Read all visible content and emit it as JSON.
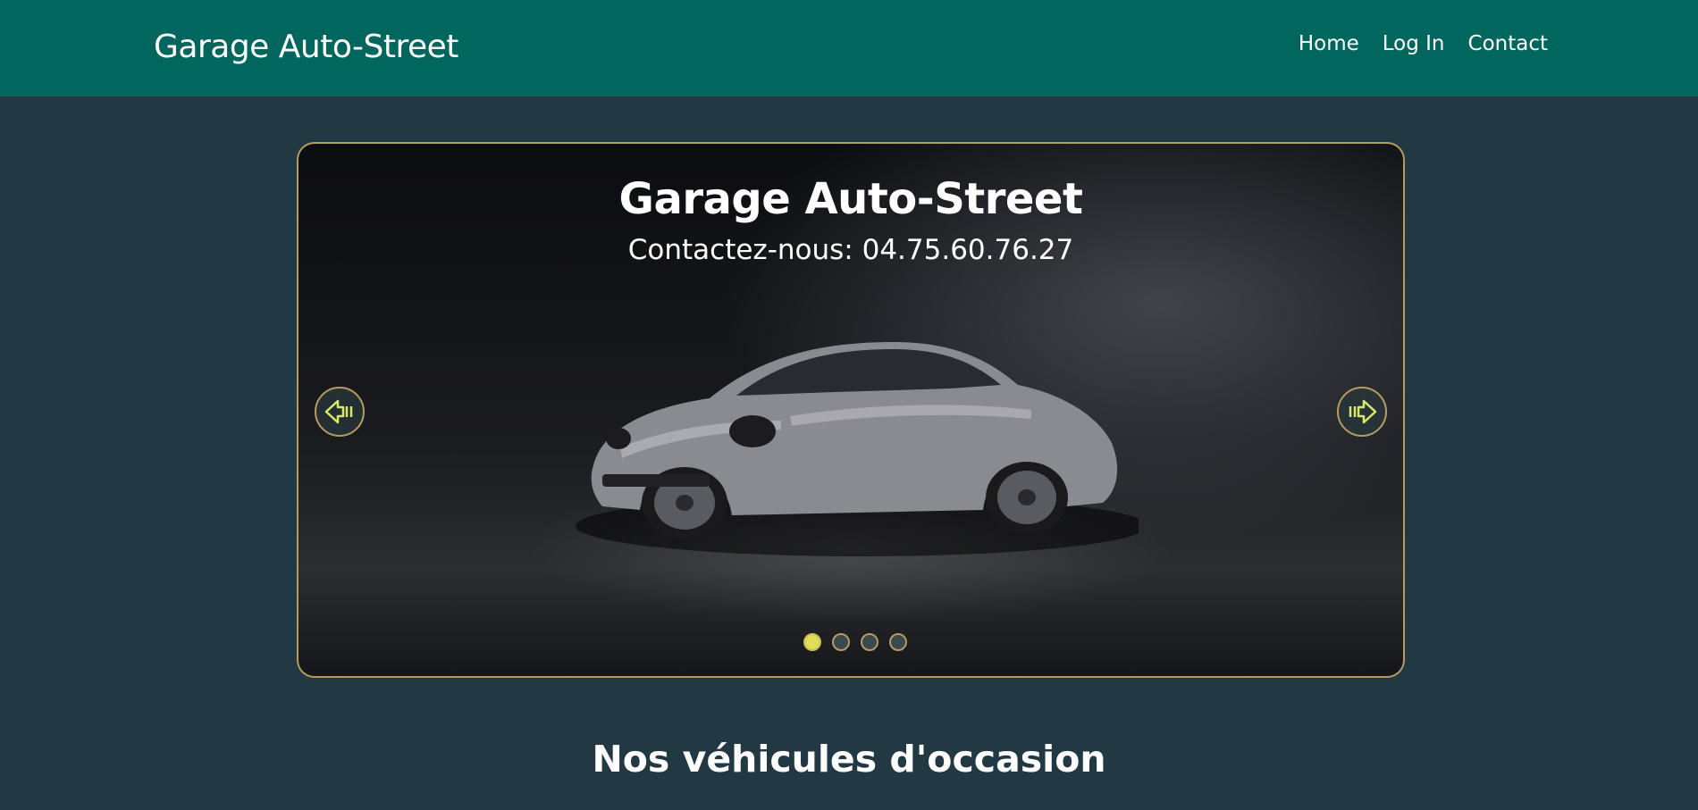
{
  "navbar": {
    "brand": "Garage Auto-Street",
    "links": [
      "Home",
      "Log In",
      "Contact"
    ]
  },
  "carousel": {
    "title": "Garage Auto-Street",
    "subtitle": "Contactez-nous: 04.75.60.76.27",
    "prev_icon": "arrow-left-icon",
    "next_icon": "arrow-right-icon",
    "slide_count": 4,
    "active_slide": 1
  },
  "section": {
    "title": "Nos véhicules d'occasion"
  },
  "colors": {
    "navbar": "#00665e",
    "page_background": "#223843",
    "carousel_border": "#b99a5e",
    "arrow_icon": "#d8e86a",
    "active_dot": "#dedc5a"
  }
}
